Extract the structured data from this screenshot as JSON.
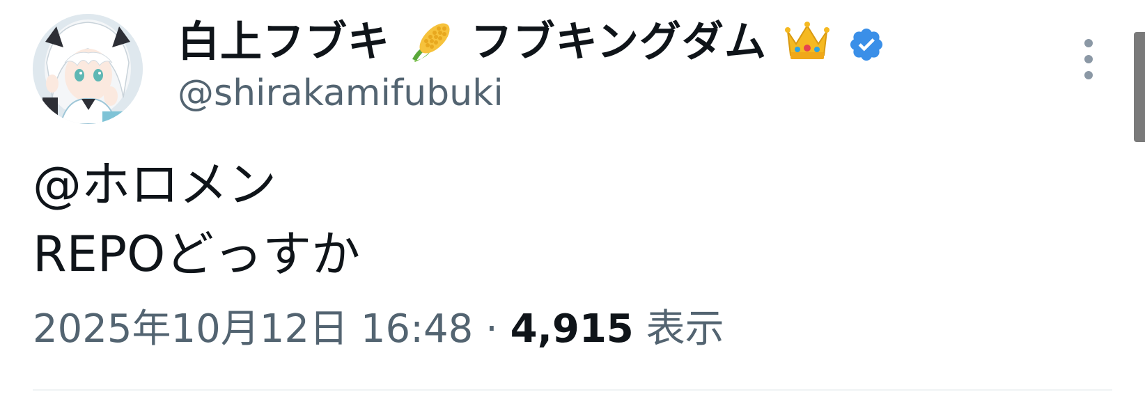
{
  "tweet": {
    "author": {
      "display_name_part1": "白上フブキ",
      "emoji_1": "corn-icon",
      "display_name_part2": "フブキングダム",
      "emoji_2": "crown-icon",
      "verified": true,
      "verified_color": "#3a8fe8",
      "handle": "@shirakamifubuki"
    },
    "text_lines": [
      "@ホロメン",
      "REPOどっすか"
    ],
    "timestamp": "2025年10月12日 16:48",
    "separator": " · ",
    "views_count": "4,915",
    "views_label": "表示"
  },
  "colors": {
    "primary_text": "#0f1419",
    "secondary_text": "#536471",
    "divider": "#eff3f4"
  }
}
